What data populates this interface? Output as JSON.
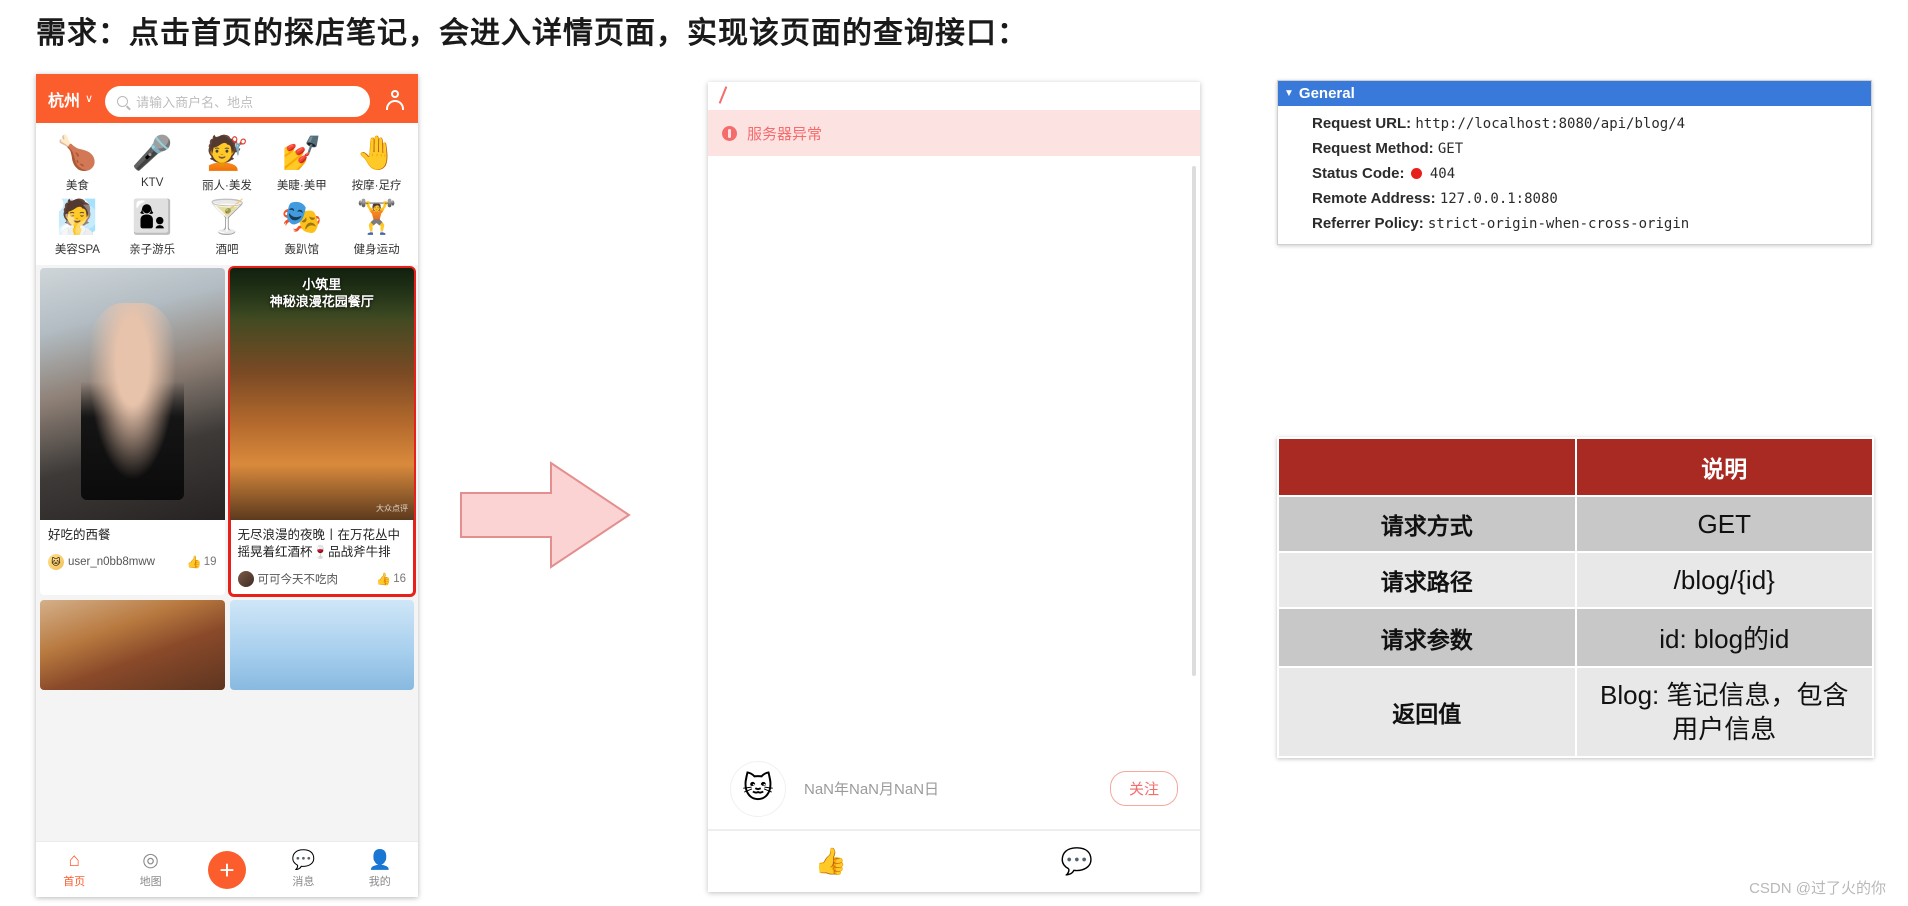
{
  "title": "需求：点击首页的探店笔记，会进入详情页面，实现该页面的查询接口：",
  "watermark": "CSDN @过了火的你",
  "phone": {
    "header": {
      "city": "杭州",
      "chevron": "chevron-down",
      "search_placeholder": "请输入商户名、地点",
      "profile_icon": "user-icon"
    },
    "categories": [
      {
        "label": "美食",
        "emoji": "🍗"
      },
      {
        "label": "KTV",
        "emoji": "🎤"
      },
      {
        "label": "丽人·美发",
        "emoji": "💇"
      },
      {
        "label": "美睫·美甲",
        "emoji": "💅"
      },
      {
        "label": "按摩·足疗",
        "emoji": "🤚"
      },
      {
        "label": "美容SPA",
        "emoji": "🧖"
      },
      {
        "label": "亲子游乐",
        "emoji": "👩‍👦"
      },
      {
        "label": "酒吧",
        "emoji": "🍸"
      },
      {
        "label": "轰趴馆",
        "emoji": "🎭"
      },
      {
        "label": "健身运动",
        "emoji": "🏋"
      }
    ],
    "notes": [
      {
        "title": "好吃的西餐",
        "overlay": "",
        "user": "user_n0bb8mww",
        "likes": "19",
        "selected": false,
        "watermark": ""
      },
      {
        "title": "无尽浪漫的夜晚丨在万花丛中\n摇晃着红酒杯🍷品战斧牛排",
        "overlay": "小筑里\n神秘浪漫花园餐厅",
        "user": "可可今天不吃肉",
        "likes": "16",
        "selected": true,
        "watermark": "大众点评"
      }
    ],
    "tabs": [
      {
        "label": "首页",
        "icon": "home-icon",
        "glyph": "🏠",
        "active": true
      },
      {
        "label": "地图",
        "icon": "map-pin-icon",
        "glyph": "◎",
        "active": false
      },
      {
        "label": "",
        "icon": "add-icon",
        "glyph": "+",
        "active": false
      },
      {
        "label": "消息",
        "icon": "message-icon",
        "glyph": "💬",
        "active": false
      },
      {
        "label": "我的",
        "icon": "person-icon",
        "glyph": "👤",
        "active": false
      }
    ]
  },
  "detail": {
    "error_icon": "error-circle-icon",
    "error_text": "服务器异常",
    "author_avatar": "cat-avatar",
    "date": "NaN年NaN月NaN日",
    "follow_label": "关注",
    "bottom_icons": [
      {
        "name": "thumbs-up-icon",
        "glyph": "👍"
      },
      {
        "name": "comment-icon",
        "glyph": "💬"
      }
    ]
  },
  "devtools": {
    "section_title": "General",
    "collapse_glyph": "▼",
    "rows": [
      {
        "key": "Request URL:",
        "value": "http://localhost:8080/api/blog/4",
        "status": false
      },
      {
        "key": "Request Method:",
        "value": "GET",
        "status": false
      },
      {
        "key": "Status Code:",
        "value": "404",
        "status": true
      },
      {
        "key": "Remote Address:",
        "value": "127.0.0.1:8080",
        "status": false
      },
      {
        "key": "Referrer Policy:",
        "value": "strict-origin-when-cross-origin",
        "status": false
      }
    ],
    "header_color": "#3879d9",
    "status_color": "#e8201c"
  },
  "api_table": {
    "header": {
      "left": "",
      "right": "说明"
    },
    "rows": [
      {
        "label": "请求方式",
        "value": "GET"
      },
      {
        "label": "请求路径",
        "value": "/blog/{id}"
      },
      {
        "label": "请求参数",
        "value": "id: blog的id"
      },
      {
        "label": "返回值",
        "value": "Blog: 笔记信息，包含\n用户信息"
      }
    ],
    "header_color": "#a82a23"
  }
}
